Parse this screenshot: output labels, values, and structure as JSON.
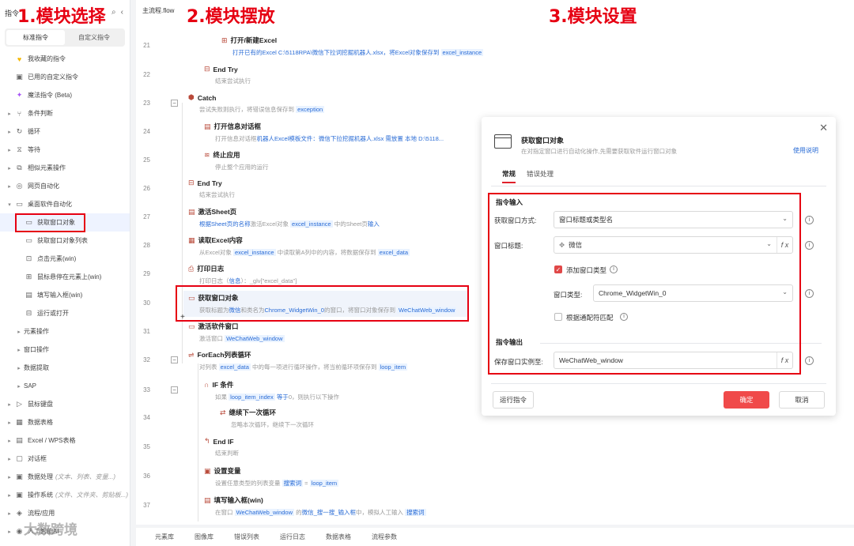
{
  "annotations": {
    "step1": "1.模块选择",
    "step2": "2.模块摆放",
    "step3": "3.模块设置"
  },
  "sidebar": {
    "header": "指令",
    "tabs": [
      "标准指令",
      "自定义指令"
    ],
    "items": [
      {
        "label": "我收藏的指令",
        "icon": "star-icon",
        "arrow": ""
      },
      {
        "label": "已用的自定义指令",
        "icon": "bag-icon",
        "arrow": ""
      },
      {
        "label": "魔法指令 (Beta)",
        "icon": "magic-icon",
        "arrow": ""
      },
      {
        "label": "条件判断",
        "icon": "branch-icon",
        "arrow": "▸"
      },
      {
        "label": "循环",
        "icon": "loop-icon",
        "arrow": "▸"
      },
      {
        "label": "等待",
        "icon": "hourglass-icon",
        "arrow": "▸"
      },
      {
        "label": "相似元素操作",
        "icon": "copy-icon",
        "arrow": "▸"
      },
      {
        "label": "网页自动化",
        "icon": "globe-icon",
        "arrow": "▸"
      },
      {
        "label": "桌面软件自动化",
        "icon": "desktop-icon",
        "arrow": "▾"
      },
      {
        "label": "获取窗口对象",
        "icon": "window-icon",
        "arrow": "",
        "sub": true
      },
      {
        "label": "获取窗口对象列表",
        "icon": "window-icon",
        "arrow": "",
        "sub": true
      },
      {
        "label": "点击元素(win)",
        "icon": "click-icon",
        "arrow": "",
        "sub": true
      },
      {
        "label": "鼠标悬停在元素上(win)",
        "icon": "hover-icon",
        "arrow": "",
        "sub": true
      },
      {
        "label": "填写输入框(win)",
        "icon": "input-icon",
        "arrow": "",
        "sub": true
      },
      {
        "label": "运行或打开",
        "icon": "run-icon",
        "arrow": "",
        "sub": true
      },
      {
        "label": "元素操作",
        "icon": "",
        "arrow": "▸",
        "sub": true
      },
      {
        "label": "窗口操作",
        "icon": "",
        "arrow": "▸",
        "sub": true
      },
      {
        "label": "数据提取",
        "icon": "",
        "arrow": "▸",
        "sub": true
      },
      {
        "label": "SAP",
        "icon": "",
        "arrow": "▸",
        "sub": true
      },
      {
        "label": "鼠标键盘",
        "icon": "mouse-icon",
        "arrow": "▸"
      },
      {
        "label": "数据表格",
        "icon": "table-icon",
        "arrow": "▸"
      },
      {
        "label": "Excel / WPS表格",
        "icon": "excel-icon",
        "arrow": "▸"
      },
      {
        "label": "对话框",
        "icon": "dialog-icon",
        "arrow": "▸"
      },
      {
        "label": "数据处理",
        "hint": "(文本、列表、变量...)",
        "icon": "data-icon",
        "arrow": "▸"
      },
      {
        "label": "操作系统",
        "hint": "(文件、文件夹、剪贴板...)",
        "icon": "os-icon",
        "arrow": "▸"
      },
      {
        "label": "流程/应用",
        "icon": "flow-icon",
        "arrow": "▸"
      },
      {
        "label": "人工智能AI",
        "icon": "ai-icon",
        "arrow": "▸"
      }
    ]
  },
  "watermark": "大数跨境",
  "editor": {
    "tab": "主流程.flow",
    "lines": [
      {
        "n": "21",
        "title": "打开/新建Excel",
        "icon": "file-icon",
        "desc": [
          [
            "t",
            "打开已有的Excel C:\\5118RPA\\微信下拉词挖掘机器人.xlsx，将Excel对象保存到 "
          ],
          [
            "v",
            "excel_instance"
          ]
        ],
        "descBlue": true
      },
      {
        "n": "22",
        "title": "End Try",
        "icon": "end-icon",
        "desc": [
          [
            "t",
            "结束尝试执行"
          ]
        ]
      },
      {
        "n": "23",
        "title": "Catch",
        "icon": "catch-icon",
        "desc": [
          [
            "t",
            "尝试失败则执行，将错误信息保存到 "
          ],
          [
            "v",
            "exception"
          ]
        ]
      },
      {
        "n": "24",
        "title": "打开信息对话框",
        "icon": "msg-icon",
        "desc": [
          [
            "t",
            "打开信息对话框"
          ],
          [
            "b",
            "机器人Excel模板文件：微信下拉挖掘机器人.xlsx  需放置 本地 D:\\5118..."
          ]
        ]
      },
      {
        "n": "25",
        "title": "终止应用",
        "icon": "stop-icon",
        "desc": [
          [
            "t",
            "停止整个应用的运行"
          ]
        ]
      },
      {
        "n": "26",
        "title": "End Try",
        "icon": "end-icon",
        "desc": [
          [
            "t",
            "结束尝试执行"
          ]
        ]
      },
      {
        "n": "27",
        "title": "激活Sheet页",
        "icon": "sheet-icon",
        "desc": [
          [
            "b",
            "根据Sheet页的名称"
          ],
          [
            "t",
            "激活Excel对象 "
          ],
          [
            "v",
            "excel_instance"
          ],
          [
            "t",
            " 中的Sheet页"
          ],
          [
            "b",
            "输入"
          ]
        ]
      },
      {
        "n": "28",
        "title": "读取Excel内容",
        "icon": "excel-read-icon",
        "desc": [
          [
            "t",
            "从Excel对象 "
          ],
          [
            "v",
            "excel_instance"
          ],
          [
            "t",
            " 中读取第A列中的内容，将数据保存到 "
          ],
          [
            "v",
            "excel_data"
          ]
        ]
      },
      {
        "n": "29",
        "title": "打印日志",
        "icon": "log-icon",
        "desc": [
          [
            "t",
            "打印日志（"
          ],
          [
            "b",
            "信息"
          ],
          [
            "t",
            "）：_glv[\"excel_data\"]"
          ]
        ]
      },
      {
        "n": "30",
        "title": "获取窗口对象",
        "icon": "window-icon",
        "desc": [
          [
            "t",
            "获取标题为"
          ],
          [
            "b",
            "微信"
          ],
          [
            "t",
            "和类名为"
          ],
          [
            "b",
            "Chrome_WidgetWin_0"
          ],
          [
            "t",
            "的窗口，将窗口对象保存到 "
          ],
          [
            "v",
            "WeChatWeb_window"
          ]
        ]
      },
      {
        "n": "31",
        "title": "激活软件窗口",
        "icon": "activate-icon",
        "desc": [
          [
            "t",
            "激活窗口 "
          ],
          [
            "v",
            "WeChatWeb_window"
          ]
        ]
      },
      {
        "n": "32",
        "title": "ForEach列表循环",
        "icon": "foreach-icon",
        "desc": [
          [
            "t",
            "对列表 "
          ],
          [
            "v",
            "excel_data"
          ],
          [
            "t",
            " 中的每一项进行循环操作，将当前循环项保存到 "
          ],
          [
            "v",
            "loop_item"
          ]
        ]
      },
      {
        "n": "33",
        "title": "IF 条件",
        "icon": "if-icon",
        "desc": [
          [
            "t",
            "如果 "
          ],
          [
            "v",
            "loop_item_index"
          ],
          [
            "t",
            " "
          ],
          [
            "b",
            "等于"
          ],
          [
            "t",
            "0，则执行以下操作"
          ]
        ]
      },
      {
        "n": "34",
        "title": "继续下一次循环",
        "icon": "continue-icon",
        "desc": [
          [
            "t",
            "忽略本次循环，继续下一次循环"
          ]
        ]
      },
      {
        "n": "35",
        "title": "End IF",
        "icon": "endif-icon",
        "desc": [
          [
            "t",
            "结束判断"
          ]
        ]
      },
      {
        "n": "36",
        "title": "设置变量",
        "icon": "var-icon",
        "desc": [
          [
            "t",
            "设置任意类型的列表变量 "
          ],
          [
            "v",
            "搜索词"
          ],
          [
            "t",
            " = "
          ],
          [
            "v",
            "loop_item"
          ]
        ]
      },
      {
        "n": "37",
        "title": "填写输入框(win)",
        "icon": "input-icon",
        "desc": [
          [
            "t",
            "在窗口 "
          ],
          [
            "v",
            "WeChatWeb_window"
          ],
          [
            "t",
            " 的"
          ],
          [
            "b",
            "微信_搜一搜_输入框"
          ],
          [
            "t",
            "中，模拟人工输入 "
          ],
          [
            "v",
            "搜索词"
          ]
        ]
      }
    ]
  },
  "bottom_tabs": [
    "元素库",
    "图像库",
    "错误列表",
    "运行日志",
    "数据表格",
    "流程参数"
  ],
  "dialog": {
    "title": "获取窗口对象",
    "subtitle": "在对指定窗口进行自动化操作,先需要获取软件运行窗口对象",
    "help": "使用说明",
    "tabs": [
      "常规",
      "错误处理"
    ],
    "input_section": "指令输入",
    "method_label": "获取窗口方式:",
    "method_value": "窗口标题或类型名",
    "title_label": "窗口标题:",
    "title_value": "微信",
    "add_type_label": "添加窗口类型",
    "add_type_checked": true,
    "type_label": "窗口类型:",
    "type_value": "Chrome_WidgetWin_0",
    "regex_label": "根据通配符匹配",
    "regex_checked": false,
    "output_section": "指令输出",
    "save_label": "保存窗口实例至:",
    "save_value": "WeChatWeb_window",
    "run_button": "运行指令",
    "ok_button": "确定",
    "cancel_button": "取消"
  },
  "colors": {
    "accent": "#e60012",
    "link": "#2a6cd6",
    "ok": "#f04a4a"
  }
}
